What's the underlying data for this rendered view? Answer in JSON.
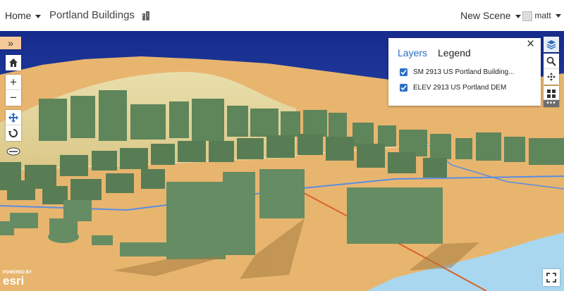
{
  "topbar": {
    "home_label": "Home",
    "app_title": "Portland Buildings",
    "new_scene_label": "New Scene",
    "user_name": "matt"
  },
  "map_controls": {
    "expand_label": "»",
    "zoom_in_label": "+",
    "zoom_out_label": "−"
  },
  "layer_panel": {
    "tabs": [
      {
        "label": "Layers",
        "active": true
      },
      {
        "label": "Legend",
        "active": false
      }
    ],
    "close_label": "×",
    "layers": [
      {
        "label": "SM 2913 US Portland Building...",
        "checked": true
      },
      {
        "label": "ELEV 2913 US Portland DEM",
        "checked": true
      }
    ]
  },
  "attribution": {
    "powered_by": "POWERED BY",
    "brand": "esri"
  },
  "colors": {
    "accent": "#2a6ec2",
    "sky": "#1f3a9e",
    "building": "#61875e",
    "ground": "#e8b56f",
    "water": "#a9d7f0",
    "expand_button": "#f5c99a"
  }
}
